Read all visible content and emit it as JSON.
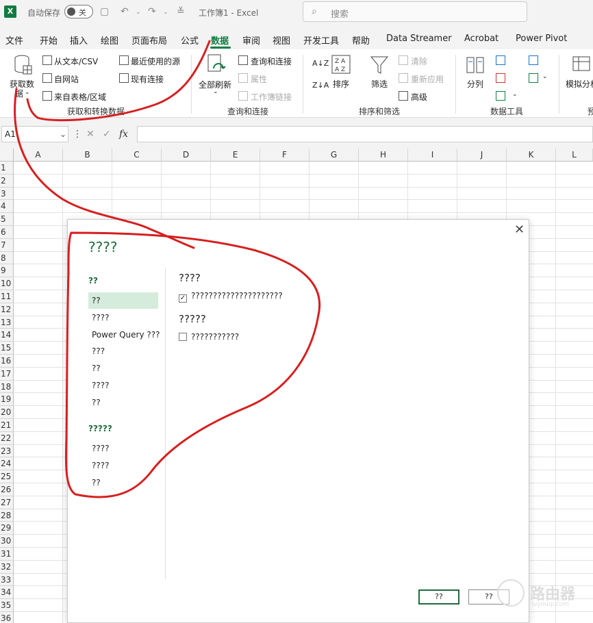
{
  "titlebar": {
    "autosave_label": "自动保存",
    "autosave_state": "关",
    "doc_title": "工作簿1  -  Excel",
    "search_placeholder": "搜索"
  },
  "menu": [
    {
      "label": "文件"
    },
    {
      "label": "开始"
    },
    {
      "label": "插入"
    },
    {
      "label": "绘图"
    },
    {
      "label": "页面布局"
    },
    {
      "label": "公式"
    },
    {
      "label": "数据"
    },
    {
      "label": "审阅"
    },
    {
      "label": "视图"
    },
    {
      "label": "开发工具"
    },
    {
      "label": "帮助"
    },
    {
      "label": "Data Streamer"
    },
    {
      "label": "Acrobat"
    },
    {
      "label": "Power Pivot"
    }
  ],
  "ribbon": {
    "get_data": "获取数",
    "get_data_2": "据",
    "from_text": "从文本/CSV",
    "from_web": "自网站",
    "from_table": "来自表格/区域",
    "recent_sources": "最近使用的源",
    "existing_conn": "现有连接",
    "group_get": "获取和转换数据",
    "refresh_all": "全部刷新",
    "queries_conn": "查询和连接",
    "properties": "属性",
    "edit_links": "工作簿链接",
    "group_queries": "查询和连接",
    "sort": "排序",
    "filter": "筛选",
    "clear": "清除",
    "reapply": "重新应用",
    "advanced": "高级",
    "group_sort": "排序和筛选",
    "split": "分列",
    "group_tools": "数据工具",
    "what_if": "模拟分析",
    "group_forecast": "预"
  },
  "formula_bar": {
    "cell_ref": "A1",
    "fx": "fx"
  },
  "grid": {
    "columns": [
      "A",
      "B",
      "C",
      "D",
      "E",
      "F",
      "G",
      "H",
      "I",
      "J",
      "K",
      "L"
    ],
    "rows": [
      "1",
      "2",
      "3",
      "4",
      "5",
      "6",
      "7",
      "8",
      "9",
      "10",
      "11",
      "12",
      "13",
      "14",
      "15",
      "16",
      "17",
      "18",
      "19",
      "20",
      "21",
      "22",
      "23",
      "24",
      "25",
      "26",
      "27",
      "28",
      "29",
      "30",
      "31",
      "32",
      "33",
      "34",
      "35",
      "36"
    ]
  },
  "dialog": {
    "title": "????",
    "nav_group1": "??",
    "nav_items1": [
      "??",
      "????",
      "Power Query ???",
      "???",
      "??",
      "????",
      "??"
    ],
    "nav_group2": "?????",
    "nav_items2": [
      "????",
      "????",
      "??"
    ],
    "section1_title": "????",
    "section1_checkbox": "?????????????????????",
    "section2_title": "?????",
    "section2_checkbox": "???????????",
    "ok_label": "??",
    "cancel_label": "??"
  },
  "watermark": {
    "text": "路由器",
    "sub": "luyouqi.com"
  },
  "colors": {
    "excel_green": "#107c41",
    "annotation_red": "#d61f1f",
    "nav_selected": "#d5ecdc"
  }
}
